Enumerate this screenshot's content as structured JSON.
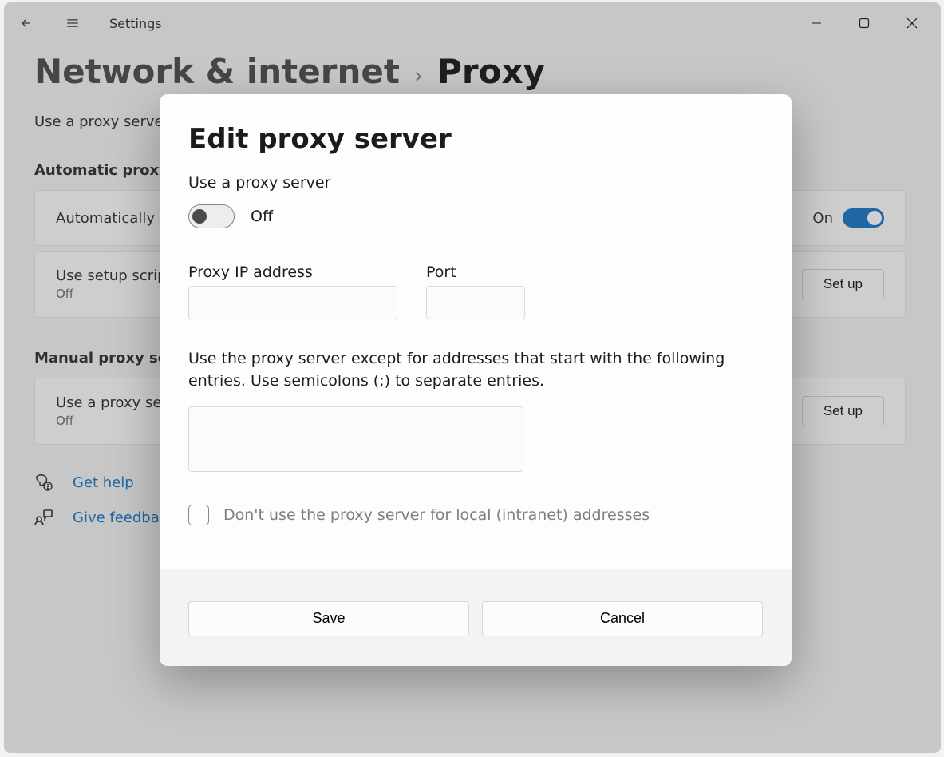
{
  "titlebar": {
    "app_title": "Settings"
  },
  "breadcrumb": {
    "parent": "Network & internet",
    "sep": "›",
    "current": "Proxy"
  },
  "page": {
    "subtitle": "Use a proxy server for Ethernet or Wi-Fi connections. These settings don't apply to VPN connections.",
    "auto": {
      "heading": "Automatic proxy setup",
      "item1": {
        "title": "Automatically detect settings",
        "toggle_label": "On"
      },
      "item2": {
        "title": "Use setup script",
        "sub": "Off",
        "button": "Set up"
      }
    },
    "manual": {
      "heading": "Manual proxy setup",
      "item1": {
        "title": "Use a proxy server",
        "sub": "Off",
        "button": "Set up"
      }
    },
    "links": {
      "help": "Get help",
      "feedback": "Give feedback"
    }
  },
  "modal": {
    "title": "Edit proxy server",
    "use_proxy_label": "Use a proxy server",
    "toggle_state": "Off",
    "ip_label": "Proxy IP address",
    "ip_value": "",
    "port_label": "Port",
    "port_value": "",
    "help_text": "Use the proxy server except for addresses that start with the following entries. Use semicolons (;) to separate entries.",
    "exclude_value": "",
    "checkbox_label": "Don't use the proxy server for local (intranet) addresses",
    "save": "Save",
    "cancel": "Cancel"
  }
}
